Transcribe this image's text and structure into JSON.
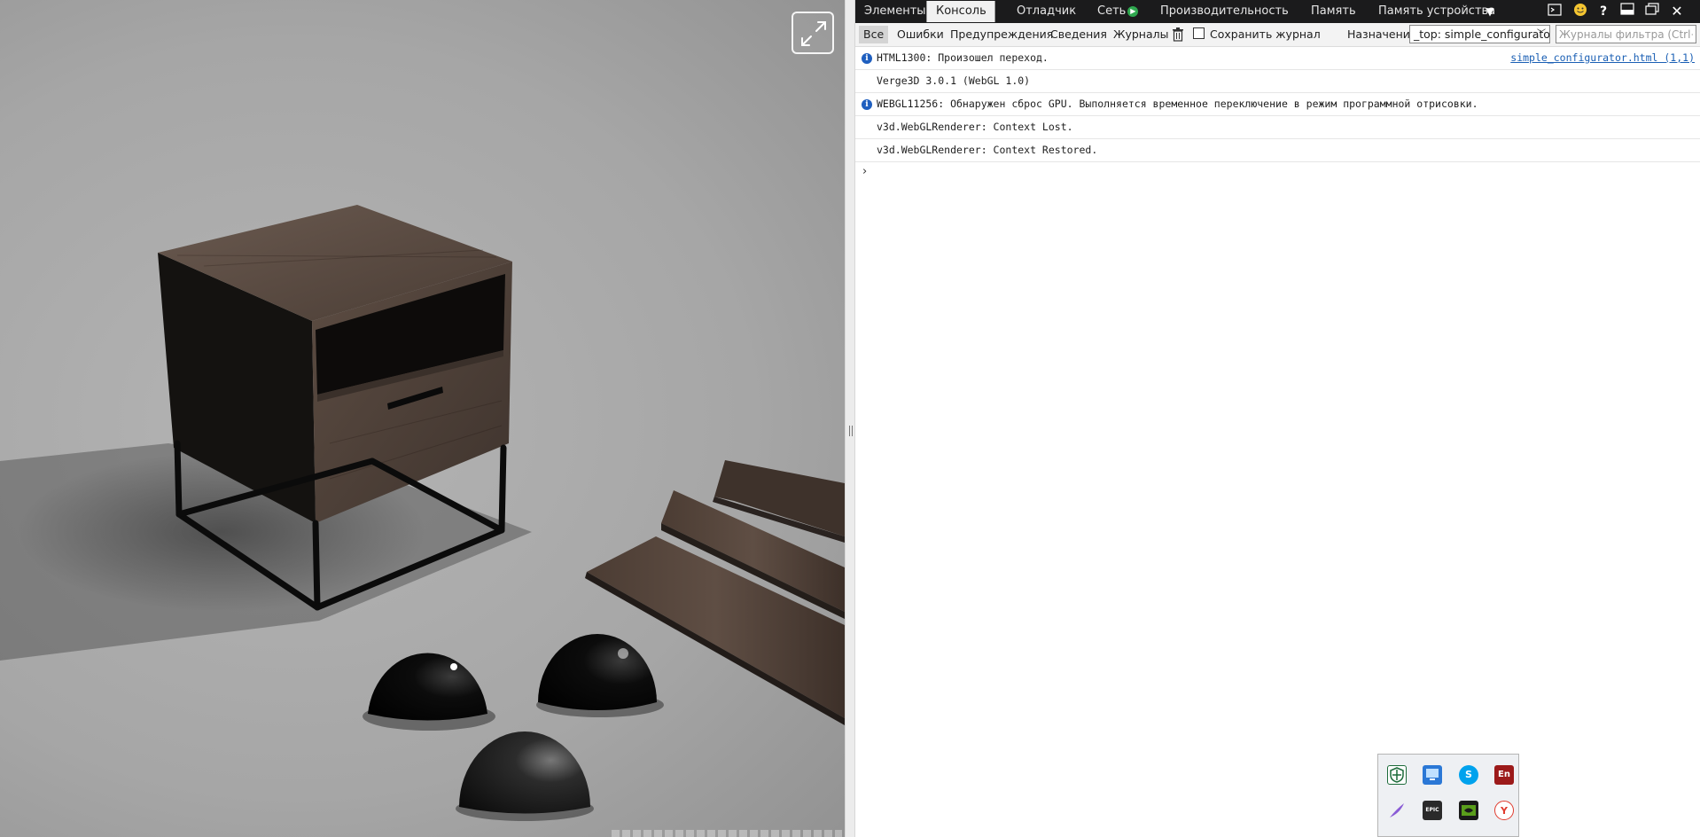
{
  "viewport": {
    "fullscreen_icon": "expand-arrows-icon",
    "colors": {
      "wood": "#5a4a40",
      "metal": "#111111",
      "floor": "#a6a6a6"
    }
  },
  "devtools": {
    "tabs": [
      {
        "label": "Элементы",
        "active": false
      },
      {
        "label": "Консоль",
        "active": true
      },
      {
        "label": "Отладчик",
        "active": false
      },
      {
        "label": "Сеть",
        "active": false
      },
      {
        "label": "Производительность",
        "active": false
      },
      {
        "label": "Память",
        "active": false
      },
      {
        "label": "Память устройства",
        "active": false
      }
    ],
    "toolbar_icons": [
      "more-tabs-icon",
      "console-icon",
      "smiley-feedback-icon",
      "help-icon",
      "dock-icon",
      "undock-icon",
      "close-icon"
    ],
    "filters": [
      {
        "label": "Все",
        "active": true
      },
      {
        "label": "Ошибки",
        "active": false
      },
      {
        "label": "Предупреждения",
        "active": false
      },
      {
        "label": "Сведения",
        "active": false
      },
      {
        "label": "Журналы",
        "active": false
      }
    ],
    "keep_log_label": "Сохранить журнал",
    "target_label": "Назначение",
    "target_value": "_top: simple_configurator",
    "filter_placeholder": "Журналы фильтра (Ctrl+F)",
    "messages": [
      {
        "type": "info",
        "text": "HTML1300: Произошел переход.",
        "source": "simple_configurator.html (1,1)"
      },
      {
        "type": "log",
        "text": "Verge3D 3.0.1 (WebGL 1.0)",
        "source": ""
      },
      {
        "type": "info",
        "text": "WEBGL11256: Обнаружен сброс GPU. Выполняется временное переключение в режим программной отрисовки.",
        "source": ""
      },
      {
        "type": "log",
        "text": "v3d.WebGLRenderer: Context Lost.",
        "source": ""
      },
      {
        "type": "log",
        "text": "v3d.WebGLRenderer: Context Restored.",
        "source": ""
      }
    ],
    "prompt_symbol": "›",
    "accent_colors": {
      "tabbar_bg": "#1b1b1c",
      "info_icon": "#1f5fbf",
      "link": "#1a5fb4"
    }
  },
  "tray": {
    "icons": [
      {
        "name": "defender-shield-icon",
        "glyph": "",
        "color": "#1c6b3a"
      },
      {
        "name": "network-monitor-icon",
        "glyph": "",
        "color": "#2b78d6"
      },
      {
        "name": "skype-icon",
        "glyph": "S",
        "color": "#00a2ed"
      },
      {
        "name": "dictionary-en-icon",
        "glyph": "En",
        "color": "#9c1a1a"
      },
      {
        "name": "feather-pen-icon",
        "glyph": "",
        "color": "#8a5cd6"
      },
      {
        "name": "epic-games-icon",
        "glyph": "EPIC",
        "color": "#2a2a2a"
      },
      {
        "name": "nvidia-icon",
        "glyph": "",
        "color": "#5a9e1b"
      },
      {
        "name": "yandex-browser-icon",
        "glyph": "Y",
        "color": "#e03b2e"
      }
    ]
  }
}
